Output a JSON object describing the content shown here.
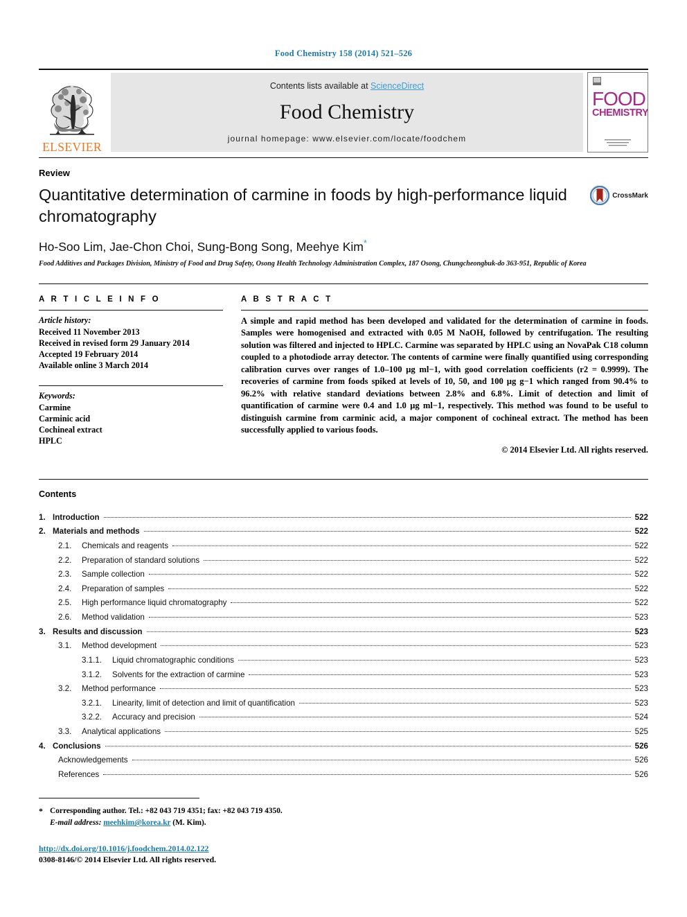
{
  "running_head": "Food Chemistry 158 (2014) 521–526",
  "masthead": {
    "publisher_wordmark": "ELSEVIER",
    "contents_prefix": "Contents lists available at ",
    "sciencedirect": "ScienceDirect",
    "journal_name": "Food Chemistry",
    "homepage": "journal homepage: www.elsevier.com/locate/foodchem",
    "cover_title_line1": "FOOD",
    "cover_title_line2": "CHEMISTRY",
    "accent_link_color": "#3c9cd7",
    "elsevier_orange": "#e87722",
    "cover_magenta": "#a52a8a"
  },
  "article": {
    "type": "Review",
    "title": "Quantitative determination of carmine in foods by high-performance liquid chromatography",
    "crossmark_label": "CrossMark",
    "authors": "Ho-Soo Lim, Jae-Chon Choi, Sung-Bong Song, Meehye Kim",
    "author_footnote_marker": "*",
    "affiliation": "Food Additives and Packages Division, Ministry of Food and Drug Safety, Osong Health Technology Administration Complex, 187 Osong, Chungcheongbuk-do 363-951, Republic of Korea"
  },
  "article_info": {
    "heading": "A R T I C L E   I N F O",
    "history_label": "Article history:",
    "history": [
      "Received 11 November 2013",
      "Received in revised form 29 January 2014",
      "Accepted 19 February 2014",
      "Available online 3 March 2014"
    ],
    "keywords_label": "Keywords:",
    "keywords": [
      "Carmine",
      "Carminic acid",
      "Cochineal extract",
      "HPLC"
    ]
  },
  "abstract": {
    "heading": "A B S T R A C T",
    "text": "A simple and rapid method has been developed and validated for the determination of carmine in foods. Samples were homogenised and extracted with 0.05 M NaOH, followed by centrifugation. The resulting solution was filtered and injected to HPLC. Carmine was separated by HPLC using an NovaPak C18 column coupled to a photodiode array detector. The contents of carmine were finally quantified using corresponding calibration curves over ranges of 1.0–100 µg ml−1, with good correlation coefficients (r2 = 0.9999). The recoveries of carmine from foods spiked at levels of 10, 50, and 100 µg g−1 which ranged from 90.4% to 96.2% with relative standard deviations between 2.8% and 6.8%. Limit of detection and limit of quantification of carmine were 0.4 and 1.0 µg ml−1, respectively. This method was found to be useful to distinguish carmine from carminic acid, a major component of cochineal extract. The method has been successfully applied to various foods.",
    "copyright": "© 2014 Elsevier Ltd. All rights reserved."
  },
  "contents": {
    "heading": "Contents",
    "entries": [
      {
        "level": 1,
        "num": "1.",
        "label": "Introduction",
        "page": "522"
      },
      {
        "level": 1,
        "num": "2.",
        "label": "Materials and methods",
        "page": "522"
      },
      {
        "level": 2,
        "num": "2.1.",
        "label": "Chemicals and reagents",
        "page": "522"
      },
      {
        "level": 2,
        "num": "2.2.",
        "label": "Preparation of standard solutions",
        "page": "522"
      },
      {
        "level": 2,
        "num": "2.3.",
        "label": "Sample collection",
        "page": "522"
      },
      {
        "level": 2,
        "num": "2.4.",
        "label": "Preparation of samples",
        "page": "522"
      },
      {
        "level": 2,
        "num": "2.5.",
        "label": "High performance liquid chromatography",
        "page": "522"
      },
      {
        "level": 2,
        "num": "2.6.",
        "label": "Method validation",
        "page": "523"
      },
      {
        "level": 1,
        "num": "3.",
        "label": "Results and discussion",
        "page": "523"
      },
      {
        "level": 2,
        "num": "3.1.",
        "label": "Method development",
        "page": "523"
      },
      {
        "level": 3,
        "num": "3.1.1.",
        "label": "Liquid chromatographic conditions",
        "page": "523"
      },
      {
        "level": 3,
        "num": "3.1.2.",
        "label": "Solvents for the extraction of carmine",
        "page": "523"
      },
      {
        "level": 2,
        "num": "3.2.",
        "label": "Method performance",
        "page": "523"
      },
      {
        "level": 3,
        "num": "3.2.1.",
        "label": "Linearity, limit of detection and limit of quantification",
        "page": "523"
      },
      {
        "level": 3,
        "num": "3.2.2.",
        "label": "Accuracy and precision",
        "page": "524"
      },
      {
        "level": 2,
        "num": "3.3.",
        "label": "Analytical applications",
        "page": "525"
      },
      {
        "level": 1,
        "num": "4.",
        "label": "Conclusions",
        "page": "526"
      },
      {
        "level": 0,
        "num": "",
        "label": "Acknowledgements",
        "page": "526"
      },
      {
        "level": 0,
        "num": "",
        "label": "References",
        "page": "526"
      }
    ]
  },
  "footnotes": {
    "corresponding_marker": "*",
    "corresponding_text": "Corresponding author. Tel.: +82 043 719 4351; fax: +82 043 719 4350.",
    "email_label": "E-mail address:",
    "email": "meehkim@korea.kr",
    "email_owner": "(M. Kim).",
    "doi": "http://dx.doi.org/10.1016/j.foodchem.2014.02.122",
    "issn_line": "0308-8146/© 2014 Elsevier Ltd. All rights reserved."
  }
}
